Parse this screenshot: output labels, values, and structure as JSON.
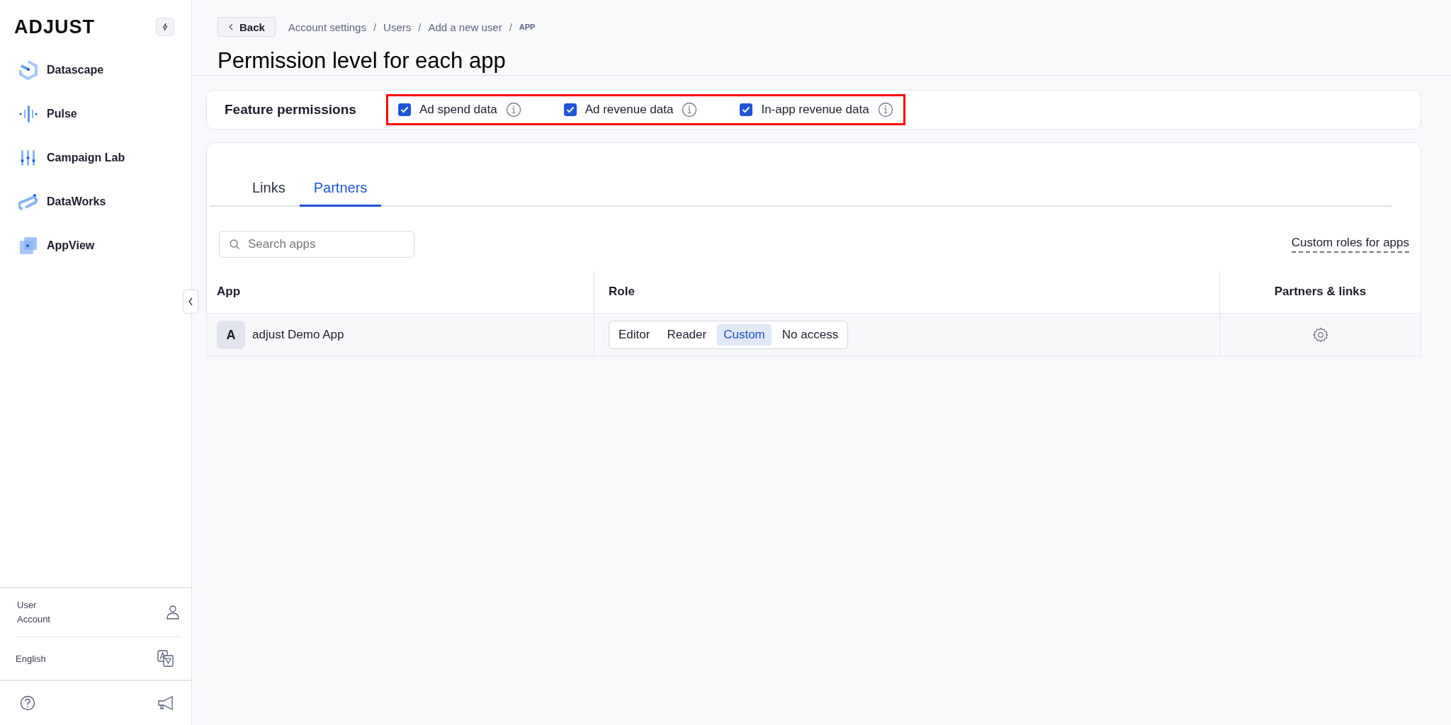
{
  "sidebar": {
    "logo": "ADJUST",
    "items": [
      {
        "label": "Datascape",
        "kind": "datascape"
      },
      {
        "label": "Pulse",
        "kind": "pulse"
      },
      {
        "label": "Campaign Lab",
        "kind": "campaign"
      },
      {
        "label": "DataWorks",
        "kind": "dataworks"
      },
      {
        "label": "AppView",
        "kind": "appview"
      }
    ],
    "account": "User\nAccount",
    "language": "English"
  },
  "header": {
    "back": "Back",
    "breadcrumbs": [
      "Account settings",
      "Users",
      "Add a new user"
    ],
    "separator": "/",
    "breadcrumb_current": "APP",
    "title": "Permission level for each app"
  },
  "feature_permissions": {
    "label": "Feature permissions",
    "highlighted": true,
    "options": [
      {
        "label": "Ad spend data",
        "checked": true
      },
      {
        "label": "Ad revenue data",
        "checked": true
      },
      {
        "label": "In-app revenue data",
        "checked": true
      }
    ]
  },
  "tabs": [
    {
      "label": "Links",
      "selected": false
    },
    {
      "label": "Partners",
      "selected": true
    }
  ],
  "search": {
    "placeholder": "Search apps"
  },
  "custom_roles_link": "Custom roles for apps",
  "table": {
    "columns": [
      "App",
      "Role",
      "Partners & links"
    ],
    "rows": [
      {
        "avatar": "A",
        "app": "adjust Demo App",
        "roles": [
          {
            "label": "Editor",
            "selected": false
          },
          {
            "label": "Reader",
            "selected": false
          },
          {
            "label": "Custom",
            "selected": true
          },
          {
            "label": "No access",
            "selected": false
          }
        ]
      }
    ]
  }
}
